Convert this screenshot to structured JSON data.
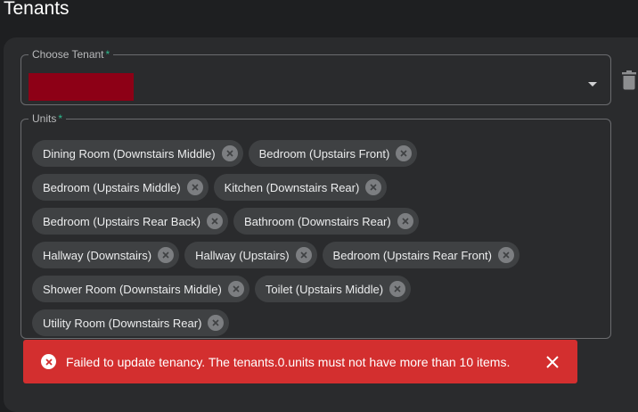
{
  "page": {
    "title": "Tenants"
  },
  "tenant_field": {
    "label": "Choose Tenant",
    "required_mark": "*",
    "value_color": "#8d0016"
  },
  "units_field": {
    "label": "Units",
    "required_mark": "*",
    "chips": [
      "Dining Room (Downstairs Middle)",
      "Bedroom (Upstairs Front)",
      "Bedroom (Upstairs Middle)",
      "Kitchen (Downstairs Rear)",
      "Bedroom (Upstairs Rear Back)",
      "Bathroom (Downstairs Rear)",
      "Hallway (Downstairs)",
      "Hallway (Upstairs)",
      "Bedroom (Upstairs Rear Front)",
      "Shower Room (Downstairs Middle)",
      "Toilet (Upstairs Middle)",
      "Utility Room (Downstairs Rear)"
    ]
  },
  "snackbar": {
    "message": "Failed to update tenancy. The tenants.0.units must not have more than 10 items.",
    "icon": "error-icon",
    "color": "#d32f2f"
  },
  "icons": {
    "delete_tenant": "trash-icon",
    "dropdown": "chevron-down-icon",
    "chip_delete": "close-circle-icon",
    "close_snackbar": "close-icon"
  }
}
